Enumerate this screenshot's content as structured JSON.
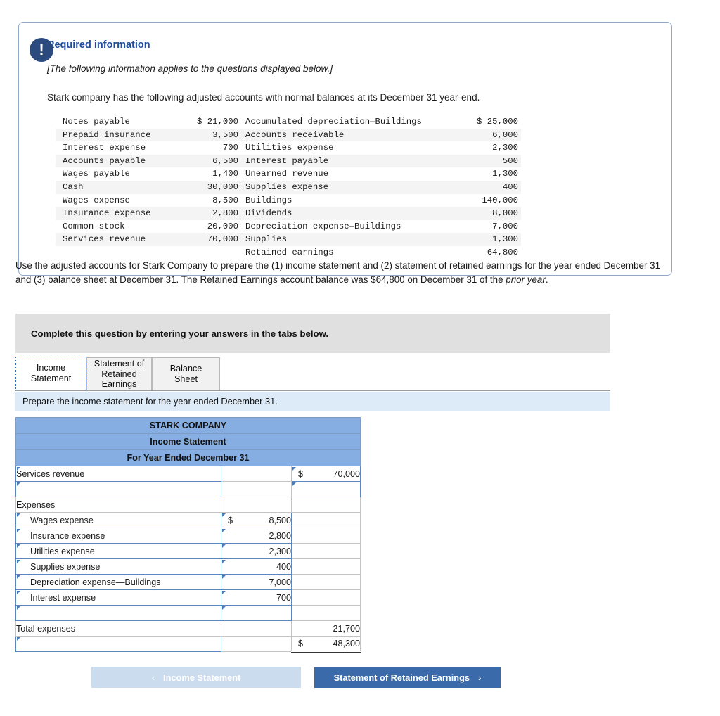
{
  "alert": {
    "icon": "exclamation-icon",
    "glyph": "!"
  },
  "required": {
    "title": "Required information",
    "note": "[The following information applies to the questions displayed below.]",
    "lead": "Stark company has the following adjusted accounts with normal balances at its December 31 year-end.",
    "accounts": [
      {
        "name1": "Notes payable",
        "cur1": "$",
        "val1": "21,000",
        "name2": "Accumulated depreciation—Buildings",
        "cur2": "$",
        "val2": "25,000"
      },
      {
        "name1": "Prepaid insurance",
        "cur1": "",
        "val1": "3,500",
        "name2": "Accounts receivable",
        "cur2": "",
        "val2": "6,000"
      },
      {
        "name1": "Interest expense",
        "cur1": "",
        "val1": "700",
        "name2": "Utilities expense",
        "cur2": "",
        "val2": "2,300"
      },
      {
        "name1": "Accounts payable",
        "cur1": "",
        "val1": "6,500",
        "name2": "Interest payable",
        "cur2": "",
        "val2": "500"
      },
      {
        "name1": "Wages payable",
        "cur1": "",
        "val1": "1,400",
        "name2": "Unearned revenue",
        "cur2": "",
        "val2": "1,300"
      },
      {
        "name1": "Cash",
        "cur1": "",
        "val1": "30,000",
        "name2": "Supplies expense",
        "cur2": "",
        "val2": "400"
      },
      {
        "name1": "Wages expense",
        "cur1": "",
        "val1": "8,500",
        "name2": "Buildings",
        "cur2": "",
        "val2": "140,000"
      },
      {
        "name1": "Insurance expense",
        "cur1": "",
        "val1": "2,800",
        "name2": "Dividends",
        "cur2": "",
        "val2": "8,000"
      },
      {
        "name1": "Common stock",
        "cur1": "",
        "val1": "20,000",
        "name2": "Depreciation expense—Buildings",
        "cur2": "",
        "val2": "7,000"
      },
      {
        "name1": "Services revenue",
        "cur1": "",
        "val1": "70,000",
        "name2": "Supplies",
        "cur2": "",
        "val2": "1,300"
      },
      {
        "name1": "",
        "cur1": "",
        "val1": "",
        "name2": "Retained earnings",
        "cur2": "",
        "val2": "64,800"
      }
    ]
  },
  "instruction": {
    "part1": "Use the adjusted accounts for Stark Company to prepare the (1) income statement and (2) statement of retained earnings for the year ended December 31 and (3) balance sheet at December 31. The Retained Earnings account balance was $64,800 on December 31 of the ",
    "italic": "prior year",
    "part2": "."
  },
  "complete_bar": {
    "text": "Complete this question by entering your answers in the tabs below."
  },
  "tabs": [
    {
      "id": "income",
      "label": "Income Statement",
      "active": true
    },
    {
      "id": "retain",
      "label": "Statement of Retained Earnings",
      "active": false
    },
    {
      "id": "balance",
      "label": "Balance Sheet",
      "active": false
    }
  ],
  "prepare_bar": {
    "text": "Prepare the income statement for the year ended December 31."
  },
  "worksheet": {
    "header": {
      "company": "STARK COMPANY",
      "statement": "Income Statement",
      "period": "For Year Ended December 31"
    },
    "rows": [
      {
        "label": "Services revenue",
        "indent": false,
        "editable_label": true,
        "mid_cur": "",
        "mid": "",
        "mid_editable": false,
        "right_cur": "$",
        "right": "70,000",
        "right_editable": true,
        "double": false
      },
      {
        "label": "",
        "indent": false,
        "editable_label": true,
        "mid_cur": "",
        "mid": "",
        "mid_editable": false,
        "right_cur": "",
        "right": "",
        "right_editable": true,
        "double": false
      },
      {
        "label": "Expenses",
        "indent": false,
        "editable_label": false,
        "mid_cur": "",
        "mid": "",
        "mid_editable": false,
        "right_cur": "",
        "right": "",
        "right_editable": false,
        "double": false
      },
      {
        "label": "Wages expense",
        "indent": true,
        "editable_label": true,
        "mid_cur": "$",
        "mid": "8,500",
        "mid_editable": true,
        "right_cur": "",
        "right": "",
        "right_editable": false,
        "double": false
      },
      {
        "label": "Insurance expense",
        "indent": true,
        "editable_label": true,
        "mid_cur": "",
        "mid": "2,800",
        "mid_editable": true,
        "right_cur": "",
        "right": "",
        "right_editable": false,
        "double": false
      },
      {
        "label": "Utilities expense",
        "indent": true,
        "editable_label": true,
        "mid_cur": "",
        "mid": "2,300",
        "mid_editable": true,
        "right_cur": "",
        "right": "",
        "right_editable": false,
        "double": false
      },
      {
        "label": "Supplies expense",
        "indent": true,
        "editable_label": true,
        "mid_cur": "",
        "mid": "400",
        "mid_editable": true,
        "right_cur": "",
        "right": "",
        "right_editable": false,
        "double": false
      },
      {
        "label": "Depreciation expense—Buildings",
        "indent": true,
        "editable_label": true,
        "mid_cur": "",
        "mid": "7,000",
        "mid_editable": true,
        "right_cur": "",
        "right": "",
        "right_editable": false,
        "double": false
      },
      {
        "label": "Interest expense",
        "indent": true,
        "editable_label": true,
        "mid_cur": "",
        "mid": "700",
        "mid_editable": true,
        "right_cur": "",
        "right": "",
        "right_editable": false,
        "double": false
      },
      {
        "label": "",
        "indent": true,
        "editable_label": true,
        "mid_cur": "",
        "mid": "",
        "mid_editable": true,
        "right_cur": "",
        "right": "",
        "right_editable": false,
        "double": false
      },
      {
        "label": "Total expenses",
        "indent": false,
        "editable_label": false,
        "mid_cur": "",
        "mid": "",
        "mid_editable": false,
        "right_cur": "",
        "right": "21,700",
        "right_editable": false,
        "double": false
      },
      {
        "label": "",
        "indent": false,
        "editable_label": true,
        "mid_cur": "",
        "mid": "",
        "mid_editable": false,
        "right_cur": "$",
        "right": "48,300",
        "right_editable": false,
        "double": true
      }
    ]
  },
  "nav": {
    "prev_label": "Income Statement",
    "prev_chevron": "‹",
    "next_label": "Statement of Retained Earnings",
    "next_chevron": "›"
  }
}
